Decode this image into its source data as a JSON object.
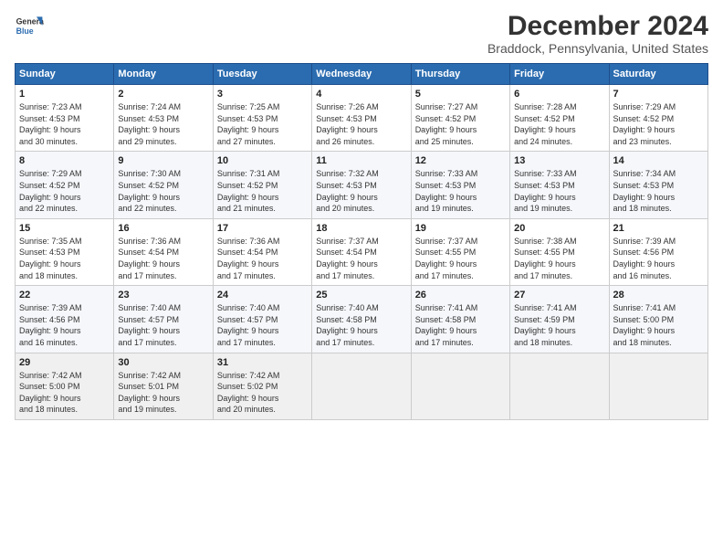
{
  "header": {
    "logo_line1": "General",
    "logo_line2": "Blue",
    "title": "December 2024",
    "subtitle": "Braddock, Pennsylvania, United States"
  },
  "columns": [
    "Sunday",
    "Monday",
    "Tuesday",
    "Wednesday",
    "Thursday",
    "Friday",
    "Saturday"
  ],
  "weeks": [
    [
      {
        "day": "1",
        "info": "Sunrise: 7:23 AM\nSunset: 4:53 PM\nDaylight: 9 hours\nand 30 minutes."
      },
      {
        "day": "2",
        "info": "Sunrise: 7:24 AM\nSunset: 4:53 PM\nDaylight: 9 hours\nand 29 minutes."
      },
      {
        "day": "3",
        "info": "Sunrise: 7:25 AM\nSunset: 4:53 PM\nDaylight: 9 hours\nand 27 minutes."
      },
      {
        "day": "4",
        "info": "Sunrise: 7:26 AM\nSunset: 4:53 PM\nDaylight: 9 hours\nand 26 minutes."
      },
      {
        "day": "5",
        "info": "Sunrise: 7:27 AM\nSunset: 4:52 PM\nDaylight: 9 hours\nand 25 minutes."
      },
      {
        "day": "6",
        "info": "Sunrise: 7:28 AM\nSunset: 4:52 PM\nDaylight: 9 hours\nand 24 minutes."
      },
      {
        "day": "7",
        "info": "Sunrise: 7:29 AM\nSunset: 4:52 PM\nDaylight: 9 hours\nand 23 minutes."
      }
    ],
    [
      {
        "day": "8",
        "info": "Sunrise: 7:29 AM\nSunset: 4:52 PM\nDaylight: 9 hours\nand 22 minutes."
      },
      {
        "day": "9",
        "info": "Sunrise: 7:30 AM\nSunset: 4:52 PM\nDaylight: 9 hours\nand 22 minutes."
      },
      {
        "day": "10",
        "info": "Sunrise: 7:31 AM\nSunset: 4:52 PM\nDaylight: 9 hours\nand 21 minutes."
      },
      {
        "day": "11",
        "info": "Sunrise: 7:32 AM\nSunset: 4:53 PM\nDaylight: 9 hours\nand 20 minutes."
      },
      {
        "day": "12",
        "info": "Sunrise: 7:33 AM\nSunset: 4:53 PM\nDaylight: 9 hours\nand 19 minutes."
      },
      {
        "day": "13",
        "info": "Sunrise: 7:33 AM\nSunset: 4:53 PM\nDaylight: 9 hours\nand 19 minutes."
      },
      {
        "day": "14",
        "info": "Sunrise: 7:34 AM\nSunset: 4:53 PM\nDaylight: 9 hours\nand 18 minutes."
      }
    ],
    [
      {
        "day": "15",
        "info": "Sunrise: 7:35 AM\nSunset: 4:53 PM\nDaylight: 9 hours\nand 18 minutes."
      },
      {
        "day": "16",
        "info": "Sunrise: 7:36 AM\nSunset: 4:54 PM\nDaylight: 9 hours\nand 17 minutes."
      },
      {
        "day": "17",
        "info": "Sunrise: 7:36 AM\nSunset: 4:54 PM\nDaylight: 9 hours\nand 17 minutes."
      },
      {
        "day": "18",
        "info": "Sunrise: 7:37 AM\nSunset: 4:54 PM\nDaylight: 9 hours\nand 17 minutes."
      },
      {
        "day": "19",
        "info": "Sunrise: 7:37 AM\nSunset: 4:55 PM\nDaylight: 9 hours\nand 17 minutes."
      },
      {
        "day": "20",
        "info": "Sunrise: 7:38 AM\nSunset: 4:55 PM\nDaylight: 9 hours\nand 17 minutes."
      },
      {
        "day": "21",
        "info": "Sunrise: 7:39 AM\nSunset: 4:56 PM\nDaylight: 9 hours\nand 16 minutes."
      }
    ],
    [
      {
        "day": "22",
        "info": "Sunrise: 7:39 AM\nSunset: 4:56 PM\nDaylight: 9 hours\nand 16 minutes."
      },
      {
        "day": "23",
        "info": "Sunrise: 7:40 AM\nSunset: 4:57 PM\nDaylight: 9 hours\nand 17 minutes."
      },
      {
        "day": "24",
        "info": "Sunrise: 7:40 AM\nSunset: 4:57 PM\nDaylight: 9 hours\nand 17 minutes."
      },
      {
        "day": "25",
        "info": "Sunrise: 7:40 AM\nSunset: 4:58 PM\nDaylight: 9 hours\nand 17 minutes."
      },
      {
        "day": "26",
        "info": "Sunrise: 7:41 AM\nSunset: 4:58 PM\nDaylight: 9 hours\nand 17 minutes."
      },
      {
        "day": "27",
        "info": "Sunrise: 7:41 AM\nSunset: 4:59 PM\nDaylight: 9 hours\nand 18 minutes."
      },
      {
        "day": "28",
        "info": "Sunrise: 7:41 AM\nSunset: 5:00 PM\nDaylight: 9 hours\nand 18 minutes."
      }
    ],
    [
      {
        "day": "29",
        "info": "Sunrise: 7:42 AM\nSunset: 5:00 PM\nDaylight: 9 hours\nand 18 minutes."
      },
      {
        "day": "30",
        "info": "Sunrise: 7:42 AM\nSunset: 5:01 PM\nDaylight: 9 hours\nand 19 minutes."
      },
      {
        "day": "31",
        "info": "Sunrise: 7:42 AM\nSunset: 5:02 PM\nDaylight: 9 hours\nand 20 minutes."
      },
      {
        "day": "",
        "info": ""
      },
      {
        "day": "",
        "info": ""
      },
      {
        "day": "",
        "info": ""
      },
      {
        "day": "",
        "info": ""
      }
    ]
  ]
}
